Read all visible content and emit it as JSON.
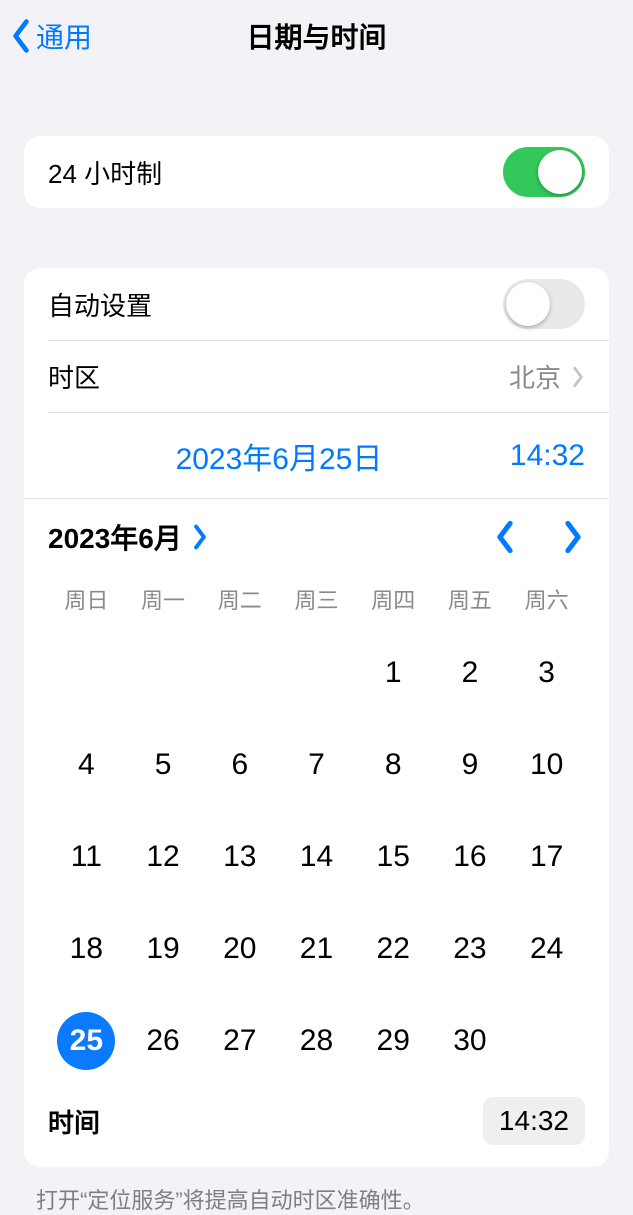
{
  "header": {
    "back": "通用",
    "title": "日期与时间"
  },
  "group1": {
    "h24_label": "24 小时制",
    "h24_on": true
  },
  "group2": {
    "auto_label": "自动设置",
    "auto_on": false,
    "tz_label": "时区",
    "tz_value": "北京",
    "selected_date": "2023年6月25日",
    "selected_time": "14:32"
  },
  "calendar": {
    "month_label": "2023年6月",
    "weekdays": [
      "周日",
      "周一",
      "周二",
      "周三",
      "周四",
      "周五",
      "周六"
    ],
    "leading_blanks": 4,
    "days_in_month": 30,
    "selected_day": 25,
    "time_label": "时间",
    "time_value": "14:32"
  },
  "footer": "打开“定位服务”将提高自动时区准确性。"
}
